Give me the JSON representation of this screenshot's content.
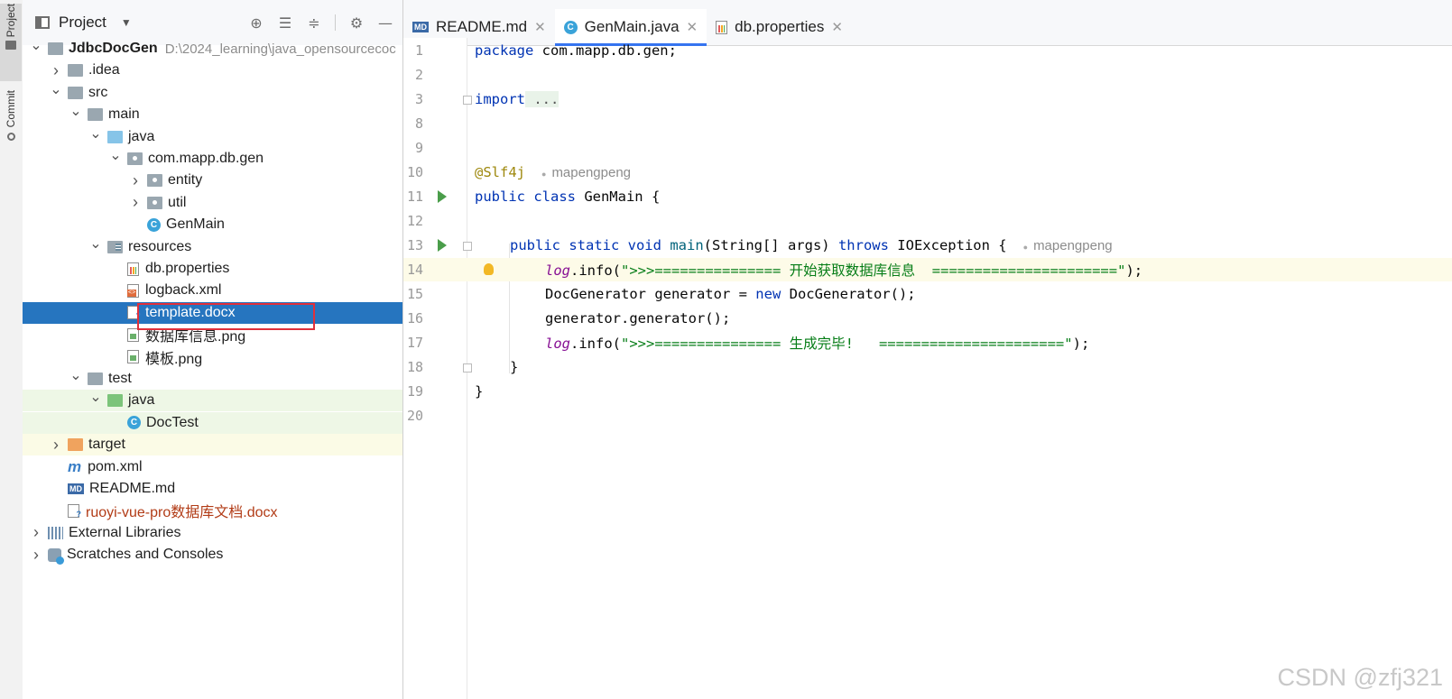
{
  "side_strip": {
    "project_label": "Project",
    "commit_label": "Commit"
  },
  "project_panel": {
    "title": "Project",
    "tree": [
      {
        "label": "JdbcDocGen",
        "path": "D:\\2024_learning\\java_opensourcecoc",
        "bold": true,
        "indent": 0,
        "arrow": "down",
        "icon": "module-folder-icon",
        "row": 0
      },
      {
        "label": ".idea",
        "indent": 1,
        "arrow": "right",
        "icon": "folder-icon",
        "row": 1
      },
      {
        "label": "src",
        "indent": 1,
        "arrow": "down",
        "icon": "folder-icon",
        "row": 2
      },
      {
        "label": "main",
        "indent": 2,
        "arrow": "down",
        "icon": "folder-icon",
        "row": 3
      },
      {
        "label": "java",
        "indent": 3,
        "arrow": "down",
        "icon": "source-folder-icon",
        "row": 4
      },
      {
        "label": "com.mapp.db.gen",
        "indent": 4,
        "arrow": "down",
        "icon": "package-icon",
        "row": 5
      },
      {
        "label": "entity",
        "indent": 5,
        "arrow": "right",
        "icon": "package-icon",
        "row": 6
      },
      {
        "label": "util",
        "indent": 5,
        "arrow": "right",
        "icon": "package-icon",
        "row": 7
      },
      {
        "label": "GenMain",
        "indent": 5,
        "arrow": "none",
        "icon": "class-icon",
        "row": 8
      },
      {
        "label": "resources",
        "indent": 3,
        "arrow": "down",
        "icon": "resources-folder-icon",
        "row": 9
      },
      {
        "label": "db.properties",
        "indent": 4,
        "arrow": "none",
        "icon": "properties-file-icon",
        "row": 10
      },
      {
        "label": "logback.xml",
        "indent": 4,
        "arrow": "none",
        "icon": "xml-file-icon",
        "row": 11
      },
      {
        "label": "template.docx",
        "indent": 4,
        "arrow": "none",
        "icon": "docx-file-icon",
        "row": 12,
        "selected": true
      },
      {
        "label": "数据库信息.png",
        "indent": 4,
        "arrow": "none",
        "icon": "png-file-icon",
        "row": 13
      },
      {
        "label": "模板.png",
        "indent": 4,
        "arrow": "none",
        "icon": "png-file-icon",
        "row": 14
      },
      {
        "label": "test",
        "indent": 2,
        "arrow": "down",
        "icon": "folder-icon",
        "row": 15
      },
      {
        "label": "java",
        "indent": 3,
        "arrow": "down",
        "icon": "test-folder-icon",
        "row": 16,
        "bg": "test"
      },
      {
        "label": "DocTest",
        "indent": 4,
        "arrow": "none",
        "icon": "class-icon",
        "row": 17,
        "bg": "test"
      },
      {
        "label": "target",
        "indent": 1,
        "arrow": "right",
        "icon": "excluded-folder-icon",
        "row": 18,
        "bg": "target"
      },
      {
        "label": "pom.xml",
        "indent": 1,
        "arrow": "none",
        "icon": "maven-icon",
        "row": 19
      },
      {
        "label": "README.md",
        "indent": 1,
        "arrow": "none",
        "icon": "markdown-icon",
        "row": 20
      },
      {
        "label": "ruoyi-vue-pro数据库文档.docx",
        "indent": 1,
        "arrow": "none",
        "icon": "docx-file-icon",
        "row": 21,
        "red": true
      },
      {
        "label": "External Libraries",
        "indent": 0,
        "arrow": "right",
        "icon": "libraries-icon",
        "row": 22
      },
      {
        "label": "Scratches and Consoles",
        "indent": 0,
        "arrow": "right",
        "icon": "scratches-icon",
        "row": 23
      }
    ]
  },
  "tabs": [
    {
      "label": "README.md",
      "icon": "markdown-icon",
      "active": false
    },
    {
      "label": "GenMain.java",
      "icon": "class-icon",
      "active": true
    },
    {
      "label": "db.properties",
      "icon": "properties-file-icon",
      "active": false
    }
  ],
  "code": {
    "line_numbers": [
      "1",
      "2",
      "3",
      "8",
      "9",
      "10",
      "11",
      "12",
      "13",
      "14",
      "15",
      "16",
      "17",
      "18",
      "19",
      "20"
    ],
    "package_kw": "package",
    "package_name": " com.mapp.db.gen;",
    "import_kw": "import",
    "import_fold": " ...",
    "annotation": "@Slf4j",
    "author_hint": "mapengpeng",
    "class_decl_kw": "public class",
    "class_name": " GenMain {",
    "method_kw": "public static void",
    "method_name": "main",
    "method_params": "(String[] args) ",
    "throws_kw": "throws",
    "throws_type": " IOException {",
    "log_field": "log",
    "log_info": ".info(",
    "str1": "\">>>=============== 开始获取数据库信息  ======================\"",
    "str_end": ");",
    "gen_decl": "DocGenerator generator = ",
    "new_kw": "new",
    "gen_ctor": " DocGenerator();",
    "gen_call": "generator.generator();",
    "str2": "\">>>=============== 生成完毕!   ======================\"",
    "close_method": "}",
    "close_class": "}"
  },
  "watermark": "CSDN @zfj321"
}
